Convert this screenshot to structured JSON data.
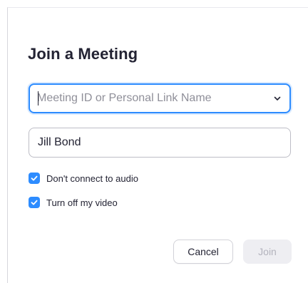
{
  "dialog": {
    "title": "Join a Meeting",
    "meeting_id": {
      "value": "",
      "placeholder": "Meeting ID or Personal Link Name",
      "icon": "chevron-down-icon"
    },
    "name_field": {
      "value": "Jill Bond"
    },
    "options": [
      {
        "label": "Don't connect to audio",
        "checked": true
      },
      {
        "label": "Turn off my video",
        "checked": true
      }
    ],
    "buttons": {
      "cancel": "Cancel",
      "join": "Join"
    }
  },
  "colors": {
    "accent": "#2d8cff",
    "text": "#232333",
    "placeholder": "#8f8f99",
    "disabled_text": "#b3b3bd",
    "disabled_bg": "#eeeef2"
  }
}
